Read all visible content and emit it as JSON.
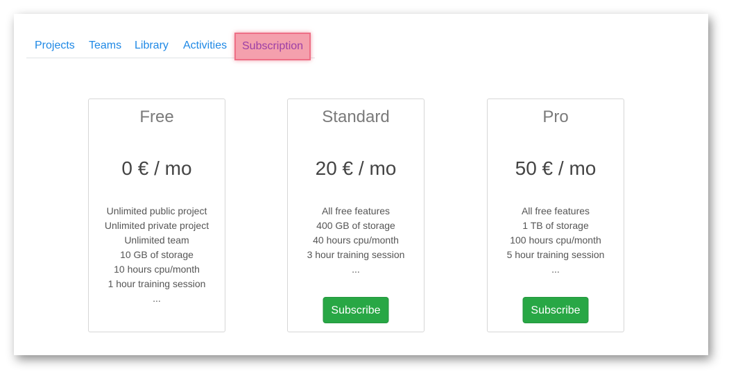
{
  "nav": {
    "items": [
      {
        "label": "Projects",
        "active": false
      },
      {
        "label": "Teams",
        "active": false
      },
      {
        "label": "Library",
        "active": false
      },
      {
        "label": "Activities",
        "active": false
      },
      {
        "label": "Subscription",
        "active": true
      }
    ]
  },
  "plans": [
    {
      "name": "Free",
      "price": "0 € / mo",
      "features": [
        "Unlimited public project",
        "Unlimited private project",
        "Unlimited team",
        "10 GB of storage",
        "10 hours cpu/month",
        "1 hour training session",
        "..."
      ]
    },
    {
      "name": "Standard",
      "price": "20 € / mo",
      "features": [
        "All free features",
        "400 GB of storage",
        "40 hours cpu/month",
        "3 hour training session",
        "..."
      ],
      "button_label": "Subscribe"
    },
    {
      "name": "Pro",
      "price": "50 € / mo",
      "features": [
        "All free features",
        "1 TB of storage",
        "100 hours cpu/month",
        "5 hour training session",
        "..."
      ],
      "button_label": "Subscribe"
    }
  ],
  "colors": {
    "link": "#1e88e5",
    "active_tab_highlight": "#f4a0ad",
    "subscribe_button": "#28a745"
  }
}
